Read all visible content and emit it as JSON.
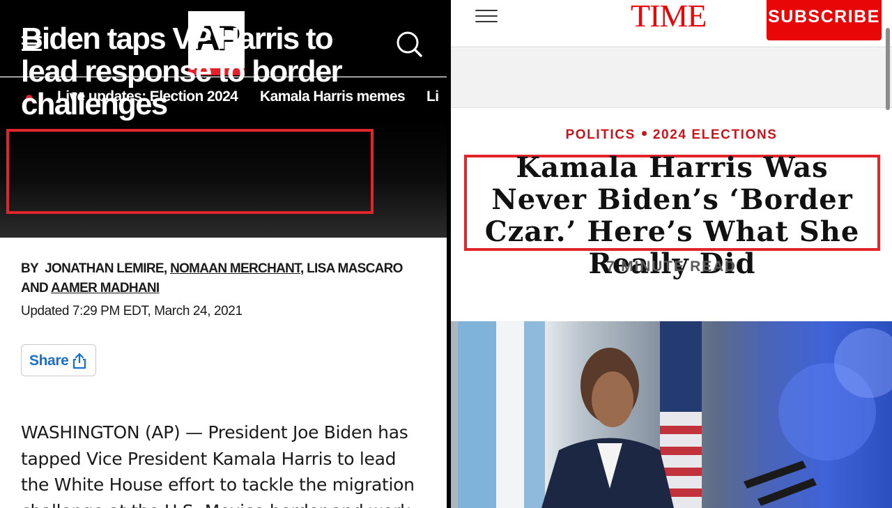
{
  "ap": {
    "logo": "AP",
    "ticker": {
      "items": [
        "Live updates: Election 2024",
        "Kamala Harris memes",
        "Li"
      ]
    },
    "headline": "Biden taps VP Harris to lead response to border challenges",
    "byline": {
      "prefix": "BY",
      "author_1": "JONATHAN LEMIRE,",
      "author_2": "NOMAAN MERCHANT",
      "author_3": ", LISA MASCARO AND",
      "author_4": "AAMER MADHANI"
    },
    "updated": "Updated 7:29 PM EDT, March 24, 2021",
    "share_label": "Share",
    "body_text": "WASHINGTON (AP) — President Joe Biden has tapped Vice President Kamala Harris to lead the White House effort to tackle the migration challenge at the U.S.-Mexico border and work"
  },
  "time": {
    "logo": "TIME",
    "subscribe_label": "SUBSCRIBE",
    "kicker": [
      "POLITICS",
      "2024 ELECTIONS"
    ],
    "headline": "Kamala Harris Was Never Biden’s ‘Border Czar.’ Here’s What She Really Did",
    "read_time": "7 MINUTE READ"
  },
  "colors": {
    "ap_red": "#e5202b",
    "highlight_box": "#e2252b",
    "time_red": "#e90606",
    "link_blue": "#1a6fc8"
  },
  "icons": [
    "menu-icon",
    "search-icon",
    "share-icon",
    "live-dot-icon"
  ]
}
